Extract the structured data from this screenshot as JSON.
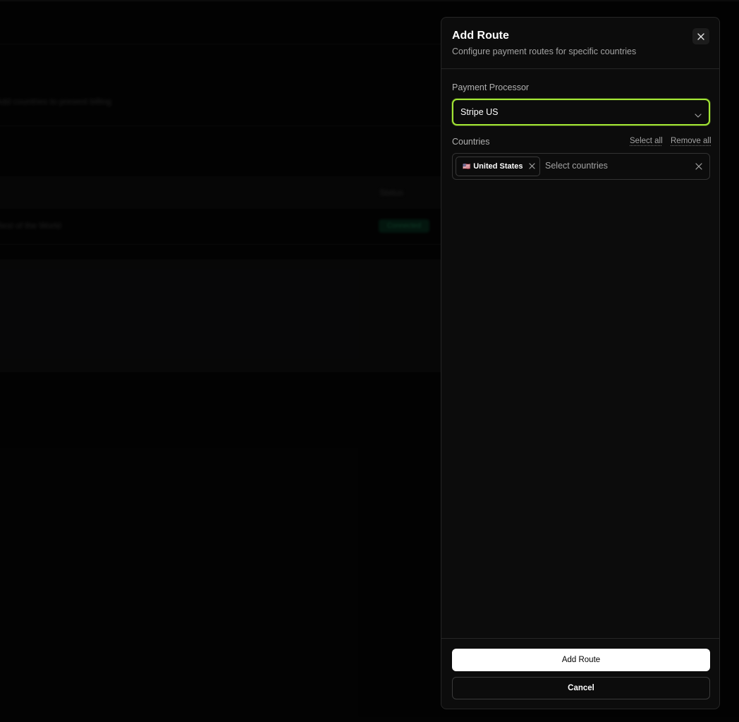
{
  "background": {
    "description_text": "Add countries to present billing",
    "table_header_col2": "Status",
    "row_name": "Rest of the World",
    "row_status": "Connected"
  },
  "drawer": {
    "title": "Add Route",
    "subtitle": "Configure payment routes for specific countries",
    "close_icon": "close-icon"
  },
  "processor": {
    "label": "Payment Processor",
    "value": "Stripe US",
    "accent_color": "#a3e635"
  },
  "countries": {
    "label": "Countries",
    "select_all": "Select all",
    "remove_all": "Remove all",
    "placeholder": "Select countries",
    "selected": [
      {
        "flag": "🇺🇸",
        "name": "United States"
      }
    ]
  },
  "footer": {
    "submit_label": "Add Route",
    "cancel_label": "Cancel"
  }
}
